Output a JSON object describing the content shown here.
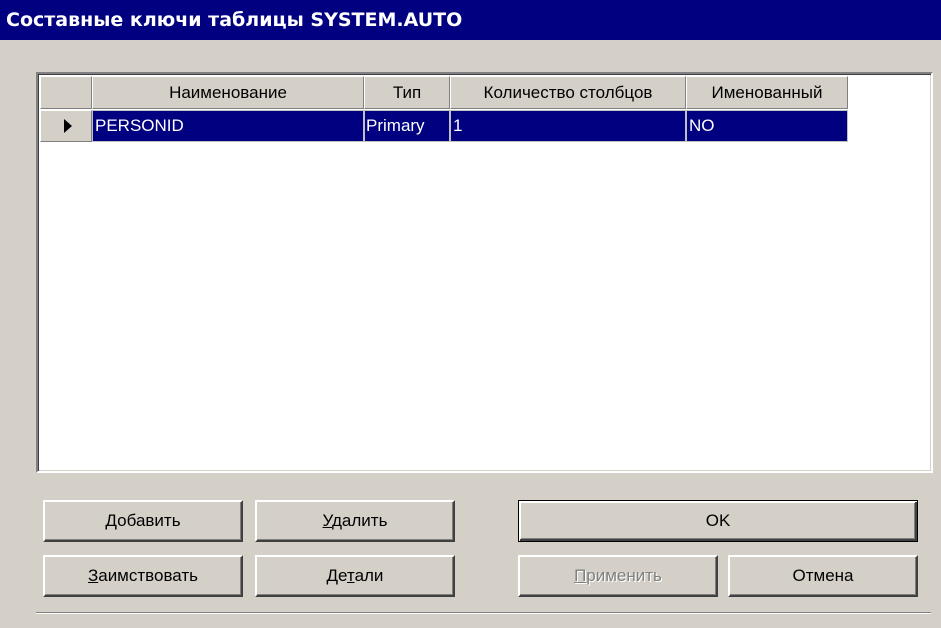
{
  "window": {
    "title": "Составные ключи таблицы SYSTEM.AUTO"
  },
  "grid": {
    "columns": [
      "Наименование",
      "Тип",
      "Количество столбцов",
      "Именованный"
    ],
    "rows": [
      {
        "name": "PERSONID",
        "type": "Primary",
        "column_count": "1",
        "named": "NO"
      }
    ],
    "selection_color": "#000080"
  },
  "buttons": {
    "add": {
      "accel": "Д",
      "rest": "обавить"
    },
    "delete": {
      "accel": "У",
      "rest": "далить"
    },
    "borrow": {
      "accel": "З",
      "rest": "аимствовать"
    },
    "details": {
      "pre": "Де",
      "accel": "т",
      "rest": "али"
    },
    "ok": "OK",
    "apply": {
      "accel": "П",
      "rest": "рименить"
    },
    "cancel": "Отмена"
  }
}
